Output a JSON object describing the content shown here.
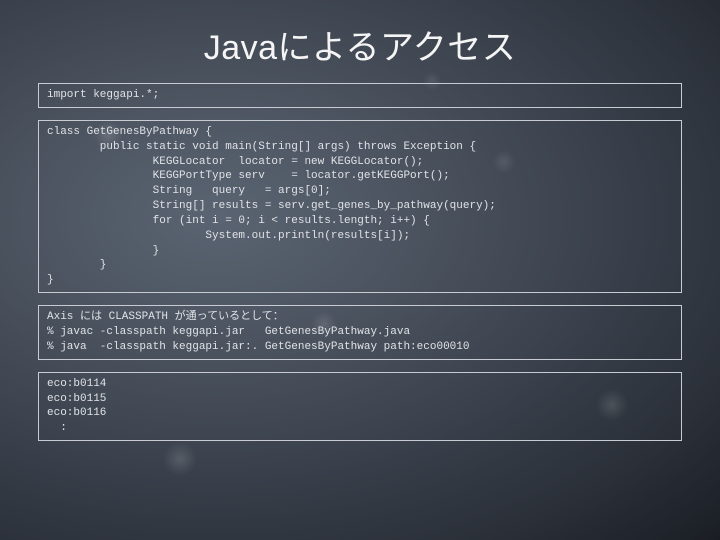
{
  "title": "Javaによるアクセス",
  "boxes": {
    "import": "import keggapi.*;",
    "class": "class GetGenesByPathway {\n        public static void main(String[] args) throws Exception {\n                KEGGLocator  locator = new KEGGLocator();\n                KEGGPortType serv    = locator.getKEGGPort();\n                String   query   = args[0];\n                String[] results = serv.get_genes_by_pathway(query);\n                for (int i = 0; i < results.length; i++) {\n                        System.out.println(results[i]);\n                }\n        }\n}",
    "compile": "Axis には CLASSPATH が通っているとして：\n% javac -classpath keggapi.jar   GetGenesByPathway.java\n% java  -classpath keggapi.jar:. GetGenesByPathway path:eco00010",
    "output": "eco:b0114\neco:b0115\neco:b0116\n  :"
  }
}
